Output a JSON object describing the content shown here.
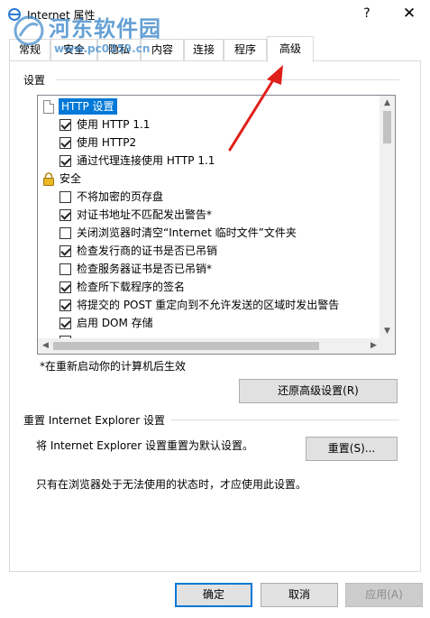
{
  "window": {
    "title": "Internet 属性",
    "help_glyph": "?",
    "close_glyph": "✕"
  },
  "watermark": {
    "name": "河东软件园",
    "url": "www.pc0359.cn"
  },
  "tabs": [
    {
      "label": "常规"
    },
    {
      "label": "安全"
    },
    {
      "label": "隐私"
    },
    {
      "label": "内容"
    },
    {
      "label": "连接"
    },
    {
      "label": "程序"
    },
    {
      "label": "高级"
    }
  ],
  "settings_group_label": "设置",
  "settings_list": [
    {
      "type": "header",
      "icon": "document-icon",
      "label": "HTTP 设置",
      "selected": true
    },
    {
      "type": "check",
      "checked": true,
      "label": "使用 HTTP 1.1"
    },
    {
      "type": "check",
      "checked": true,
      "label": "使用 HTTP2"
    },
    {
      "type": "check",
      "checked": true,
      "label": "通过代理连接使用 HTTP 1.1"
    },
    {
      "type": "header",
      "icon": "lock-icon",
      "label": "安全"
    },
    {
      "type": "check",
      "checked": false,
      "label": "不将加密的页存盘"
    },
    {
      "type": "check",
      "checked": true,
      "label": "对证书地址不匹配发出警告*"
    },
    {
      "type": "check",
      "checked": false,
      "label": "关闭浏览器时清空“Internet 临时文件”文件夹"
    },
    {
      "type": "check",
      "checked": true,
      "label": "检查发行商的证书是否已吊销"
    },
    {
      "type": "check",
      "checked": false,
      "label": "检查服务器证书是否已吊销*"
    },
    {
      "type": "check",
      "checked": true,
      "label": "检查所下载程序的签名"
    },
    {
      "type": "check",
      "checked": true,
      "label": "将提交的 POST 重定向到不允许发送的区域时发出警告"
    },
    {
      "type": "check",
      "checked": true,
      "label": "启用 DOM 存储"
    }
  ],
  "restart_note": "*在重新启动你的计算机后生效",
  "restore_button": "还原高级设置(R)",
  "reset_group_label": "重置 Internet Explorer 设置",
  "reset_description": "将 Internet Explorer 设置重置为默认设置。",
  "reset_button": "重置(S)...",
  "reset_note": "只有在浏览器处于无法使用的状态时，才应使用此设置。",
  "footer": {
    "ok": "确定",
    "cancel": "取消",
    "apply": "应用(A)"
  },
  "colors": {
    "selection": "#0078d7",
    "default_button_border": "#0078d7",
    "annotation_arrow": "#e0201b",
    "watermark": "#3a86c9"
  }
}
